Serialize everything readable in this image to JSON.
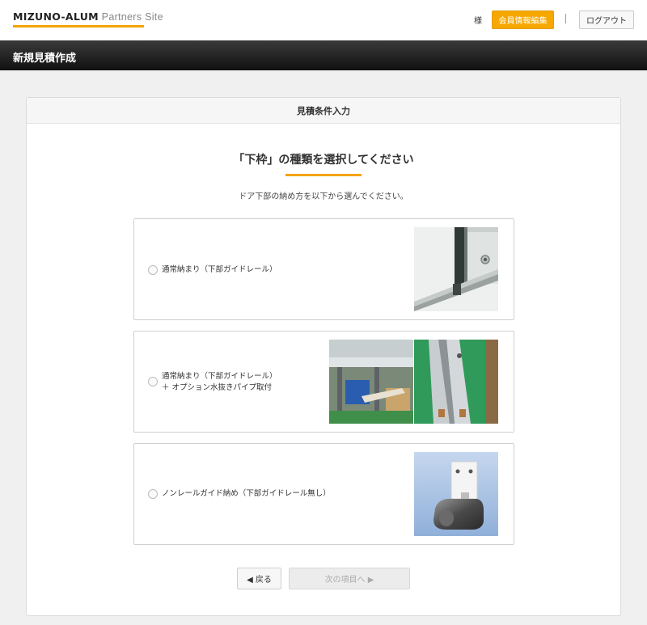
{
  "header": {
    "logo_strong": "MIZUNO-ALUM",
    "logo_light": " Partners Site",
    "user_suffix": "様",
    "member_edit_label": "会員情報編集",
    "logout_label": "ログアウト",
    "accent_color": "#f5a300"
  },
  "page": {
    "title": "新規見積作成"
  },
  "panel": {
    "header": "見積条件入力",
    "question_title": "「下枠」の種類を選択してください",
    "question_desc": "ドア下部の納め方を以下から選んでください。",
    "options": [
      {
        "line1": "通常納まり（下部ガイドレール）",
        "line2": ""
      },
      {
        "line1": "通常納まり（下部ガイドレール）",
        "line2": "＋ オプション水抜きパイプ取付"
      },
      {
        "line1": "ノンレールガイド納め（下部ガイドレール無し）",
        "line2": ""
      }
    ],
    "back_label": "◀ 戻る",
    "next_label": "次の項目へ ▶"
  }
}
